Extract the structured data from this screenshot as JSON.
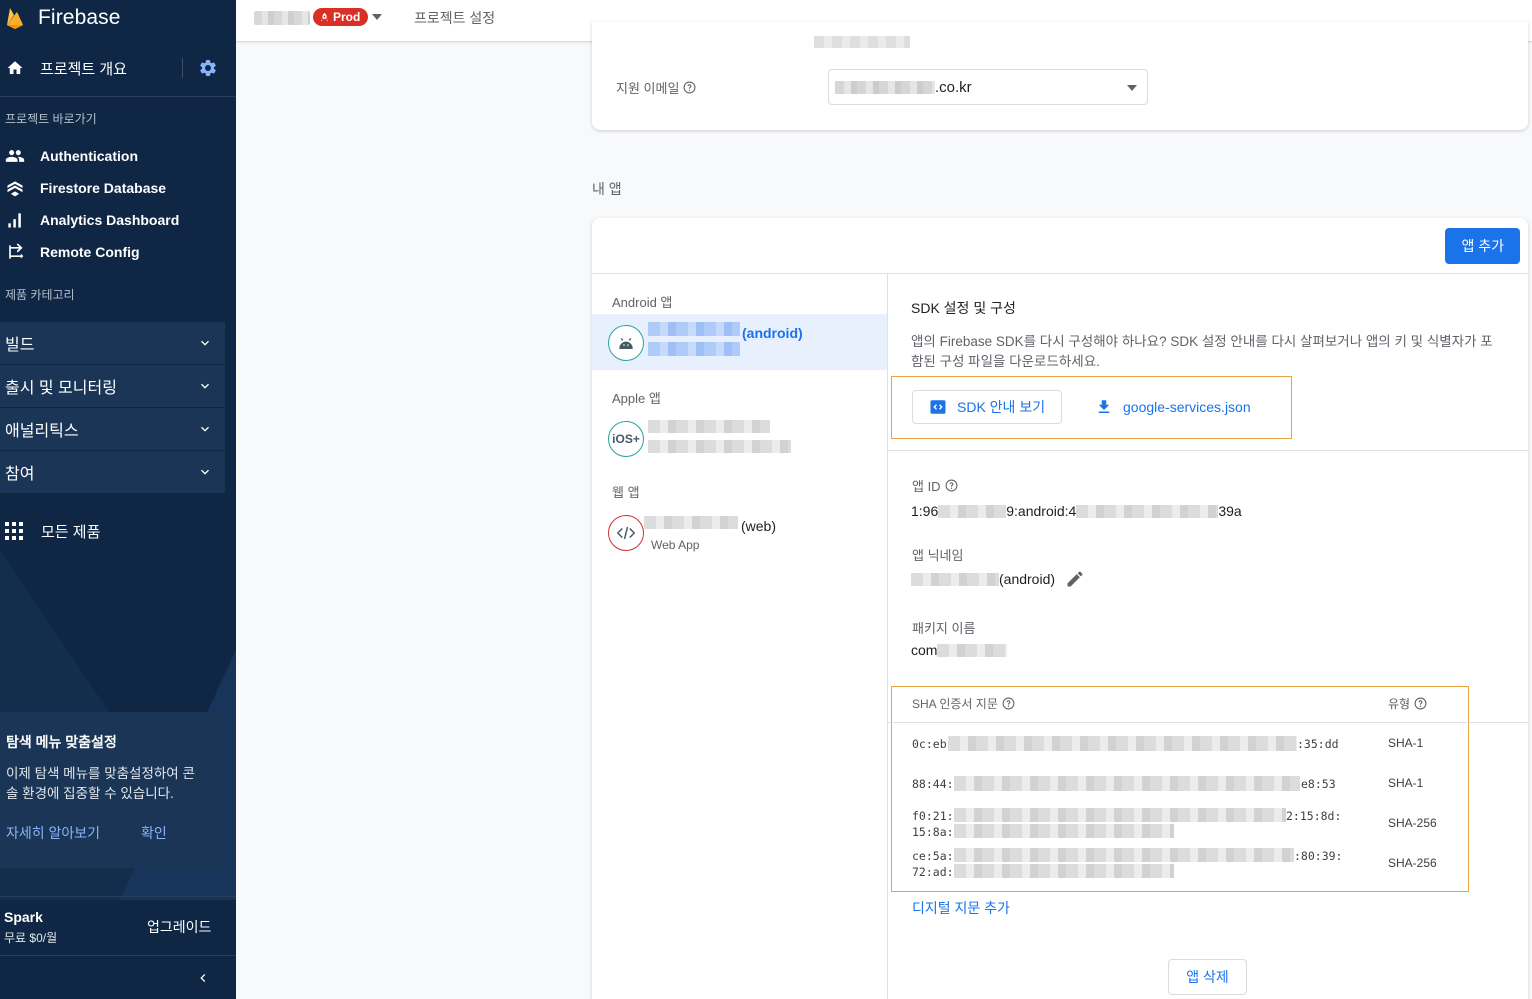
{
  "sidebar": {
    "brand": "Firebase",
    "overview_label": "프로젝트 개요",
    "shortcuts_label": "프로젝트 바로가기",
    "shortcuts": [
      {
        "label": "Authentication",
        "icon": "people-icon"
      },
      {
        "label": "Firestore Database",
        "icon": "firestore-icon"
      },
      {
        "label": "Analytics Dashboard",
        "icon": "bar-chart-icon"
      },
      {
        "label": "Remote Config",
        "icon": "remote-config-icon"
      }
    ],
    "categories_label": "제품 카테고리",
    "categories": [
      {
        "label": "빌드"
      },
      {
        "label": "출시 및 모니터링"
      },
      {
        "label": "애널리틱스"
      },
      {
        "label": "참여"
      }
    ],
    "all_products_label": "모든 제품",
    "customize_card": {
      "title": "탐색 메뉴 맞춤설정",
      "body": "이제 탐색 메뉴를 맞춤설정하여 콘솔 환경에 집중할 수 있습니다.",
      "learn_more": "자세히 알아보기",
      "confirm": "확인"
    },
    "plan": {
      "name": "Spark",
      "price": "무료 $0/월",
      "upgrade": "업그레이드"
    }
  },
  "topbar": {
    "env_badge": "Prod",
    "breadcrumb": "프로젝트 설정"
  },
  "settings": {
    "support_email_label": "지원 이메일",
    "support_email_suffix": ".co.kr"
  },
  "apps": {
    "section_label": "내 앱",
    "add_app_label": "앱 추가",
    "android_label": "Android 앱",
    "android_app_suffix": "(android)",
    "apple_label": "Apple 앱",
    "ios_icon_text": "iOS+",
    "web_label": "웹 앱",
    "web_app_suffix": "(web)",
    "web_app_sub": "Web App"
  },
  "details": {
    "sdk_title": "SDK 설정 및 구성",
    "sdk_desc": "앱의 Firebase SDK를 다시 구성해야 하나요? SDK 설정 안내를 다시 살펴보거나 앱의 키 및 식별자가 포함된 구성 파일을 다운로드하세요.",
    "sdk_guide_button": "SDK 안내 보기",
    "download_config": "google-services.json",
    "app_id_label": "앱 ID",
    "app_id_prefix": "1:96",
    "app_id_middle": "9:android:4",
    "app_id_suffix": "39a",
    "nickname_label": "앱 닉네임",
    "nickname_suffix": "(android)",
    "package_label": "패키지 이름",
    "package_prefix": "com",
    "sha_header": "SHA 인증서 지문",
    "type_header": "유형",
    "fingerprints": [
      {
        "start": "0c:eb",
        "end": ":35:dd",
        "start2": "",
        "type": "SHA-1"
      },
      {
        "start": "88:44:",
        "end": "e8:53",
        "start2": "",
        "type": "SHA-1"
      },
      {
        "start": "f0:21:",
        "end": "2:15:8d:",
        "start2": "15:8a:",
        "type": "SHA-256"
      },
      {
        "start": "ce:5a:",
        "end": ":80:39:",
        "start2": "72:ad:",
        "type": "SHA-256"
      }
    ],
    "add_fingerprint": "디지털 지문 추가",
    "delete_app": "앱 삭제"
  },
  "colors": {
    "sidebar_bg": "#0f2744",
    "accent": "#1a73e8",
    "highlight_border": "#e8a33d",
    "prod_badge": "#d93025"
  }
}
